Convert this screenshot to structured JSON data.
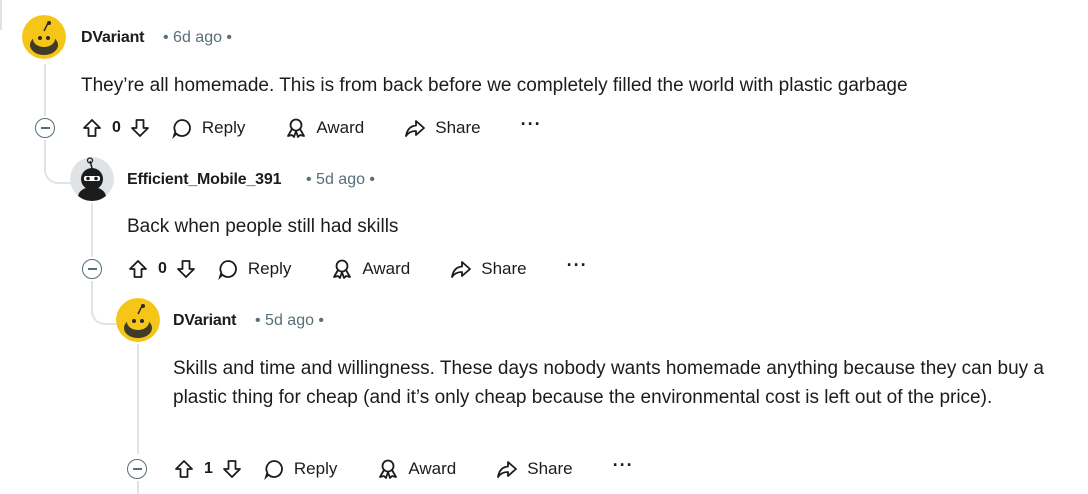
{
  "comments": [
    {
      "author": "DVariant",
      "time": "6d ago",
      "body": "They’re all homemade. This is from back before we completely filled the world with plastic garbage",
      "score": "0",
      "reply_label": "Reply",
      "award_label": "Award",
      "share_label": "Share",
      "more_label": "···"
    },
    {
      "author": "Efficient_Mobile_391",
      "time": "5d ago",
      "body": "Back when people still had skills",
      "score": "0",
      "reply_label": "Reply",
      "award_label": "Award",
      "share_label": "Share",
      "more_label": "···"
    },
    {
      "author": "DVariant",
      "time": "5d ago",
      "body": "Skills and time and willingness. These days nobody wants homemade anything because they can buy a plastic thing for cheap (and it’s only cheap because the environmental cost is left out of the price).",
      "score": "1",
      "reply_label": "Reply",
      "award_label": "Award",
      "share_label": "Share",
      "more_label": "···"
    }
  ],
  "colors": {
    "meta": "#576f76",
    "thread_line": "#e0e3e6",
    "avatar_yellow": "#f5c518"
  }
}
